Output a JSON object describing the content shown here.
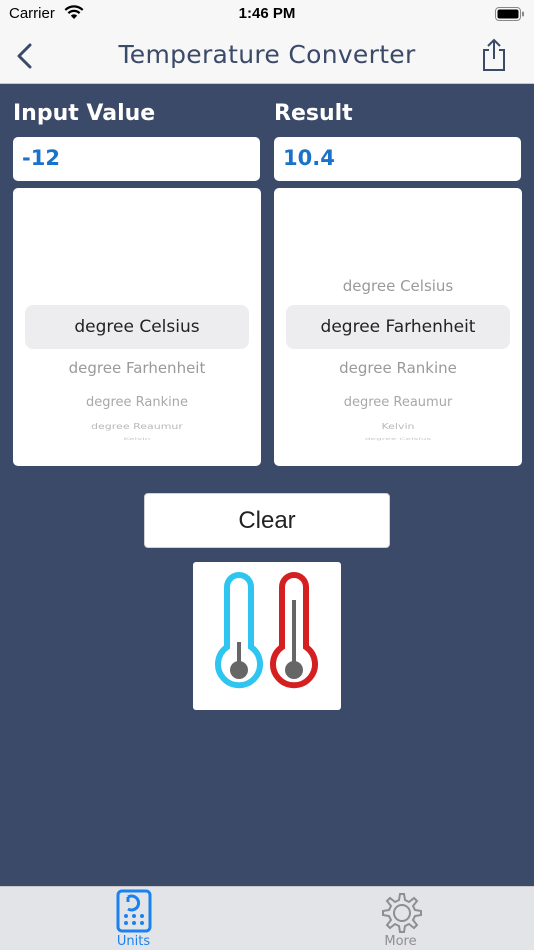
{
  "status_bar": {
    "carrier": "Carrier",
    "time": "1:46 PM"
  },
  "nav": {
    "title": "Temperature Converter",
    "back_icon": "chevron-left-icon",
    "share_icon": "share-icon"
  },
  "input": {
    "label": "Input Value",
    "value": "-12"
  },
  "result": {
    "label": "Result",
    "value": "10.4"
  },
  "input_picker": {
    "selected": "degree Celsius",
    "below": [
      "degree Farhenheit",
      "degree Rankine",
      "degree Reaumur",
      "Kelvin"
    ]
  },
  "result_picker": {
    "above": [
      "degree Celsius"
    ],
    "selected": "degree Farhenheit",
    "below": [
      "degree Rankine",
      "degree Reaumur",
      "Kelvin",
      "degree Celsius"
    ]
  },
  "clear_label": "Clear",
  "tabs": [
    {
      "label": "Units",
      "icon": "units-calculator-icon",
      "active": true
    },
    {
      "label": "More",
      "icon": "gear-icon",
      "active": false
    }
  ],
  "colors": {
    "background": "#3b4a69",
    "accent": "#1a73c8",
    "cold": "#2ec5f0",
    "hot": "#d42020",
    "tab_active": "#1a82f0"
  }
}
